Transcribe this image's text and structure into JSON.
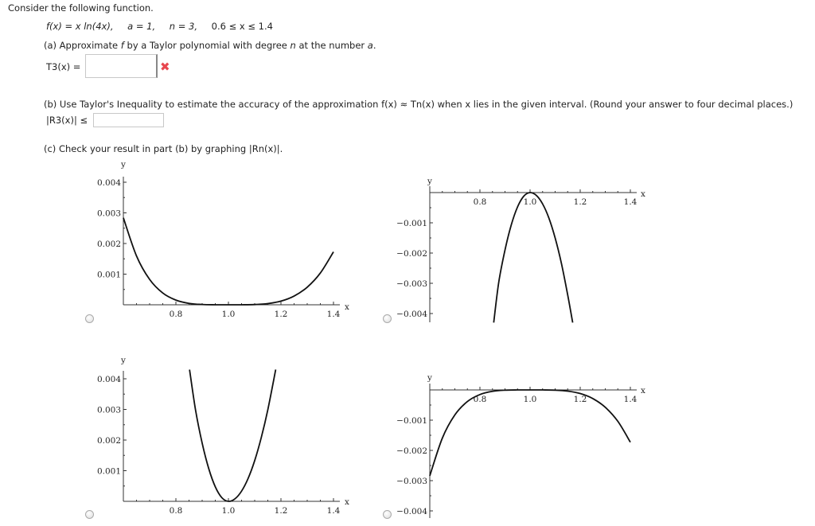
{
  "intro": "Consider the following function.",
  "given": {
    "f": "f(x) = x ln(4x),",
    "a": "a = 1,",
    "n": "n = 3,",
    "interval": "0.6 ≤ x ≤ 1.4"
  },
  "part_a": {
    "prompt_pre": "(a) Approximate ",
    "prompt_f": "f",
    "prompt_mid": " by a Taylor polynomial with degree ",
    "prompt_n": "n",
    "prompt_post": " at the number ",
    "prompt_a": "a",
    "prompt_end": ".",
    "label": "T3(x) =",
    "value": "",
    "status": "incorrect"
  },
  "part_b": {
    "prompt": "(b) Use Taylor's Inequality to estimate the accuracy of the approximation  f(x) ≈ Tn(x)  when x lies in the given interval. (Round your answer to four decimal places.)",
    "label": "|R3(x)| ≤",
    "value": ""
  },
  "part_c": {
    "prompt": "(c) Check your result in part (b) by graphing  |Rn(x)|."
  },
  "colors": {
    "error": "#e8474f",
    "curve": "#111111"
  },
  "chart_data": [
    {
      "type": "line",
      "xlabel": "x",
      "ylabel": "y",
      "xlim": [
        0.6,
        1.4
      ],
      "ylim": [
        0,
        0.0043
      ],
      "xticks": [
        "0.8",
        "1.0",
        "1.2",
        "1.4"
      ],
      "xtick_values": [
        0.8,
        1.0,
        1.2,
        1.4
      ],
      "yticks": [
        "0.001",
        "0.002",
        "0.003",
        "0.004"
      ],
      "ytick_values": [
        0.001,
        0.002,
        0.003,
        0.004
      ],
      "x": [
        0.6,
        0.65,
        0.7,
        0.75,
        0.8,
        0.85,
        0.9,
        0.95,
        1.0,
        1.05,
        1.1,
        1.15,
        1.2,
        1.25,
        1.3,
        1.35,
        1.4
      ],
      "y": [
        0.00284,
        0.001595,
        0.000827,
        0.000384,
        0.000152,
        4.63e-05,
        8.9e-06,
        5e-07,
        0,
        5e-07,
        7.8e-06,
        3.88e-05,
        0.000119,
        0.000284,
        0.000574,
        0.001037,
        0.001728
      ],
      "selected": false
    },
    {
      "type": "line",
      "xlabel": "x",
      "ylabel": "y",
      "xlim": [
        0.6,
        1.4
      ],
      "ylim": [
        -0.0043,
        0
      ],
      "xticks": [
        "0.8",
        "1.0",
        "1.2",
        "1.4"
      ],
      "xtick_values": [
        0.8,
        1.0,
        1.2,
        1.4
      ],
      "yticks": [
        "−0.001",
        "−0.002",
        "−0.003",
        "−0.004"
      ],
      "ytick_values": [
        -0.001,
        -0.002,
        -0.003,
        -0.004
      ],
      "x": [
        0.855,
        0.875,
        0.9,
        0.925,
        0.95,
        0.975,
        1.0,
        1.025,
        1.05,
        1.075,
        1.1,
        1.125,
        1.15,
        1.17
      ],
      "y": [
        -0.0043,
        -0.00297,
        -0.0019,
        -0.00107,
        -0.000475,
        -0.000119,
        0,
        -9.4e-05,
        -0.000375,
        -0.00084,
        -0.0015,
        -0.00234,
        -0.00338,
        -0.0043
      ],
      "selected": false
    },
    {
      "type": "line",
      "xlabel": "x",
      "ylabel": "y",
      "xlim": [
        0.6,
        1.4
      ],
      "ylim": [
        0,
        0.0043
      ],
      "xticks": [
        "0.8",
        "1.0",
        "1.2",
        "1.4"
      ],
      "xtick_values": [
        0.8,
        1.0,
        1.2,
        1.4
      ],
      "yticks": [
        "0.001",
        "0.002",
        "0.003",
        "0.004"
      ],
      "ytick_values": [
        0.001,
        0.002,
        0.003,
        0.004
      ],
      "x": [
        0.852,
        0.875,
        0.9,
        0.925,
        0.95,
        0.975,
        1.0,
        1.025,
        1.05,
        1.075,
        1.1,
        1.125,
        1.15,
        1.18
      ],
      "y": [
        0.0043,
        0.00297,
        0.0019,
        0.00107,
        0.000475,
        0.000119,
        0,
        8.3e-05,
        0.000333,
        0.000748,
        0.00133,
        0.00208,
        0.00299,
        0.0043
      ],
      "selected": false
    },
    {
      "type": "line",
      "xlabel": "x",
      "ylabel": "y",
      "xlim": [
        0.6,
        1.4
      ],
      "ylim": [
        -0.0043,
        0
      ],
      "xticks": [
        "0.8",
        "1.0",
        "1.2",
        "1.4"
      ],
      "xtick_values": [
        0.8,
        1.0,
        1.2,
        1.4
      ],
      "yticks": [
        "−0.001",
        "−0.002",
        "−0.003",
        "−0.004"
      ],
      "ytick_values": [
        -0.001,
        -0.002,
        -0.003,
        -0.004
      ],
      "x": [
        0.6,
        0.65,
        0.7,
        0.75,
        0.8,
        0.85,
        0.9,
        0.95,
        1.0,
        1.05,
        1.1,
        1.15,
        1.2,
        1.25,
        1.3,
        1.35,
        1.4
      ],
      "y": [
        -0.00284,
        -0.001595,
        -0.000827,
        -0.000384,
        -0.000152,
        -4.63e-05,
        -8.9e-06,
        -5e-07,
        0,
        -5e-07,
        -7.8e-06,
        -3.88e-05,
        -0.000119,
        -0.000284,
        -0.000574,
        -0.001037,
        -0.001728
      ],
      "selected": false
    }
  ]
}
